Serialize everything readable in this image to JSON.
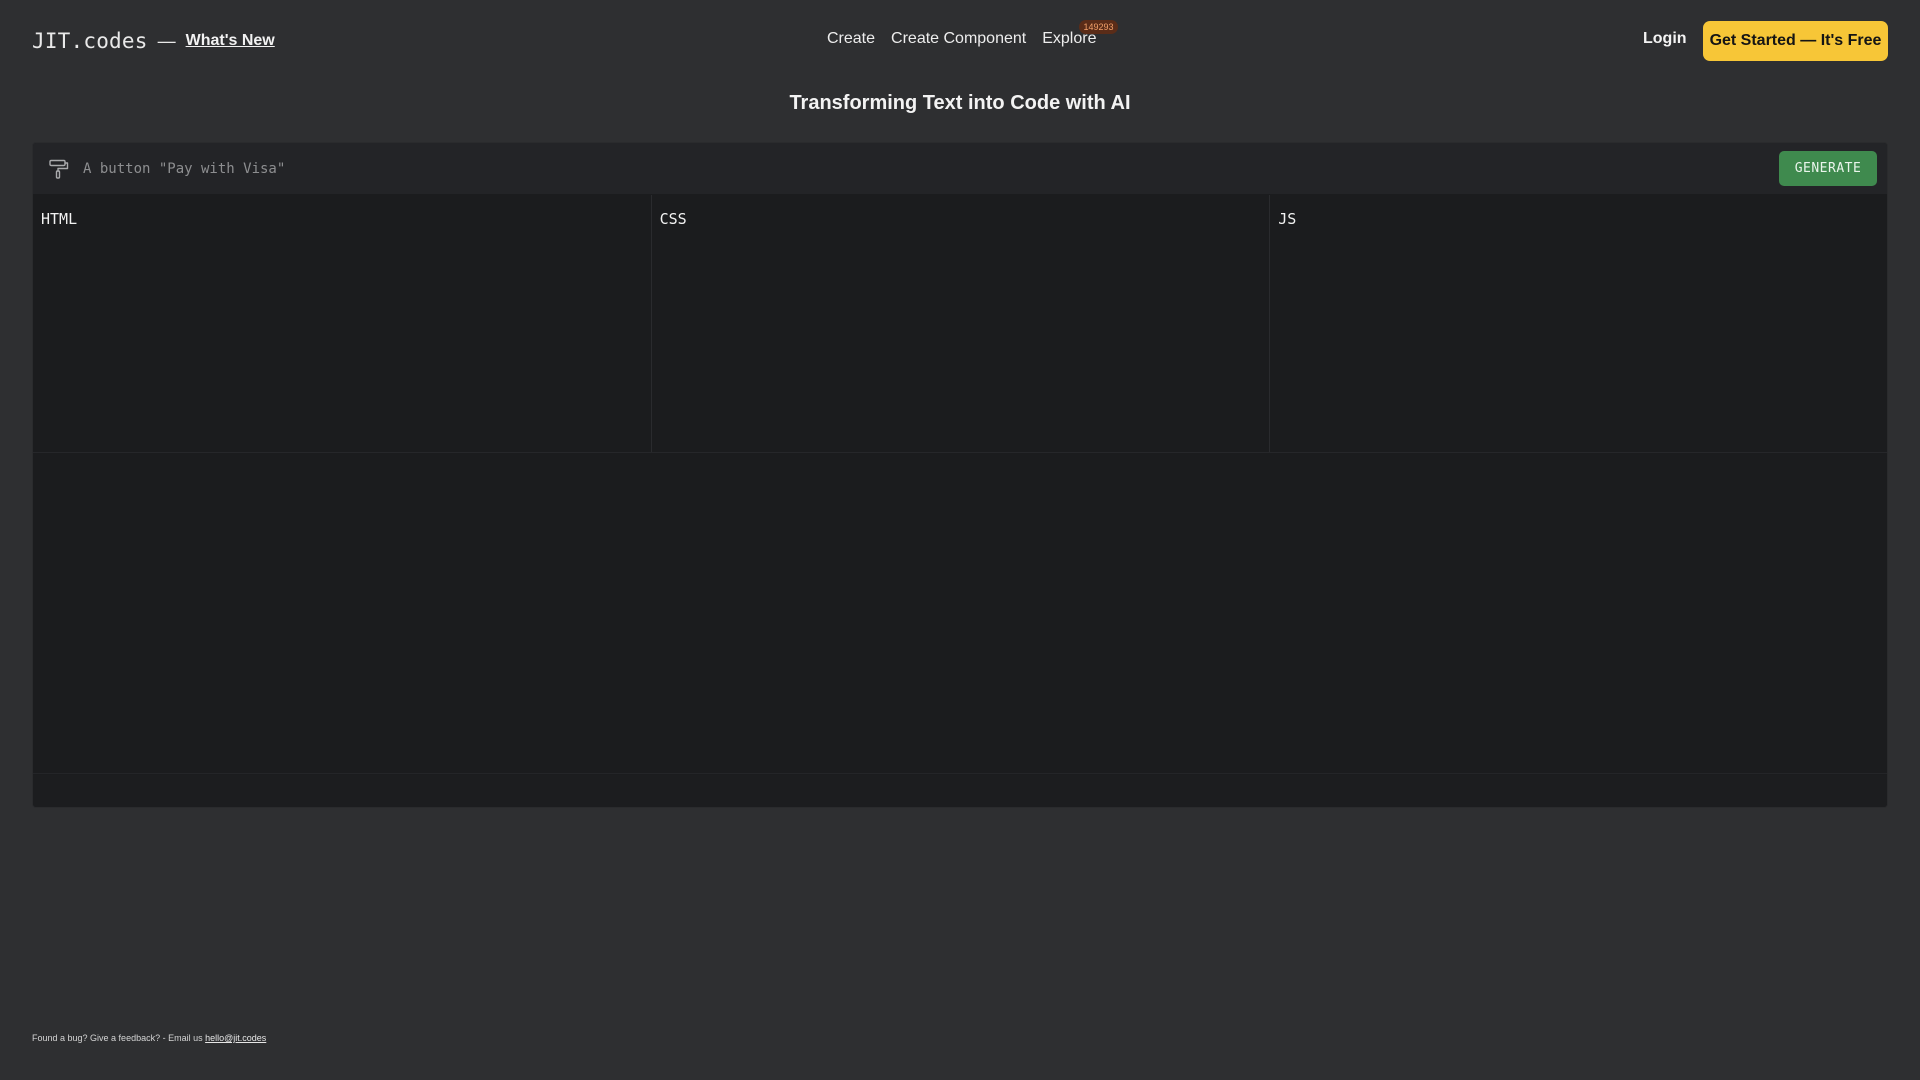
{
  "header": {
    "logo": "JIT.codes",
    "separator": "—",
    "whats_new": "What's New",
    "nav": [
      {
        "label": "Create"
      },
      {
        "label": "Create Component"
      },
      {
        "label": "Explore"
      }
    ],
    "explore_badge": "149293",
    "login": "Login",
    "cta": "Get Started — It's Free"
  },
  "main": {
    "title": "Transforming Text into Code with AI",
    "prompt": {
      "placeholder": "A button \"Pay with Visa\"",
      "value": "",
      "icon": "paint-roller-icon"
    },
    "generate_label": "GENERATE",
    "editors": [
      {
        "label": "HTML"
      },
      {
        "label": "CSS"
      },
      {
        "label": "JS"
      }
    ]
  },
  "footer": {
    "text": "Found a bug? Give a feedback? - Email us ",
    "email": "hello@jit.codes"
  },
  "colors": {
    "background": "#2e2f31",
    "panel": "#1b1c1e",
    "accent_yellow": "#f7c637",
    "generate_green": "#3f8a4e",
    "badge_bg": "#5a2c18",
    "badge_text": "#f1a06a"
  }
}
